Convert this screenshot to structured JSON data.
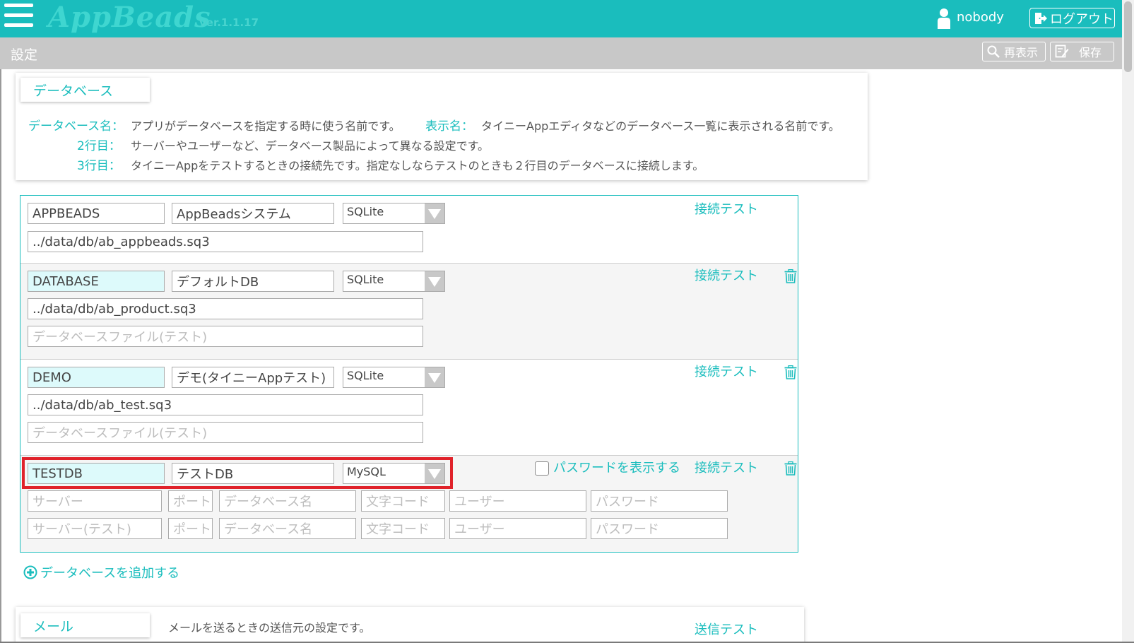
{
  "header": {
    "logo": "AppBeads",
    "version": "ver.1.1.17",
    "user_name": "nobody",
    "logout_label": "ログアウト"
  },
  "subheader": {
    "title": "設定",
    "reload_label": "再表示",
    "save_label": "保存"
  },
  "database_section": {
    "tab_label": "データベース",
    "info": {
      "name_key": "データベース名：",
      "name_desc": "アプリがデータベースを指定する時に使う名前です。",
      "display_key": "表示名：",
      "display_desc": "タイニーAppエディタなどのデータベース一覧に表示される名前です。",
      "line2_key": "2行目：",
      "line2_desc": "サーバーやユーザーなど、データベース製品によって異なる設定です。",
      "line3_key": "3行目：",
      "line3_desc": "タイニーAppをテストするときの接続先です。指定なしならテストのときも２行目のデータベースに接続します。"
    },
    "connect_test_label": "接続テスト",
    "show_password_label": "パスワードを表示する",
    "add_database_label": "データベースを追加する",
    "rows": [
      {
        "name": "APPBEADS",
        "display": "AppBeadsシステム",
        "type": "SQLite",
        "file": "../data/db/ab_appbeads.sq3"
      },
      {
        "name": "DATABASE",
        "display": "デフォルトDB",
        "type": "SQLite",
        "file": "../data/db/ab_product.sq3",
        "file_test_placeholder": "データベースファイル(テスト)"
      },
      {
        "name": "DEMO",
        "display": "デモ(タイニーAppテスト)",
        "type": "SQLite",
        "file": "../data/db/ab_test.sq3",
        "file_test_placeholder": "データベースファイル(テスト)"
      },
      {
        "name": "TESTDB",
        "display": "テストDB",
        "type": "MySQL",
        "placeholders": {
          "server": "サーバー",
          "port": "ポート",
          "dbname": "データベース名",
          "charset": "文字コード",
          "user": "ユーザー",
          "password": "パスワード",
          "server_test": "サーバー(テスト)"
        }
      }
    ]
  },
  "mail_section": {
    "tab_label": "メール",
    "desc": "メールを送るときの送信元の設定です。",
    "send_test_label": "送信テスト"
  },
  "colors": {
    "accent": "#1abdbd",
    "key_field_bg": "#ddfafb",
    "highlight": "#e0222a"
  }
}
